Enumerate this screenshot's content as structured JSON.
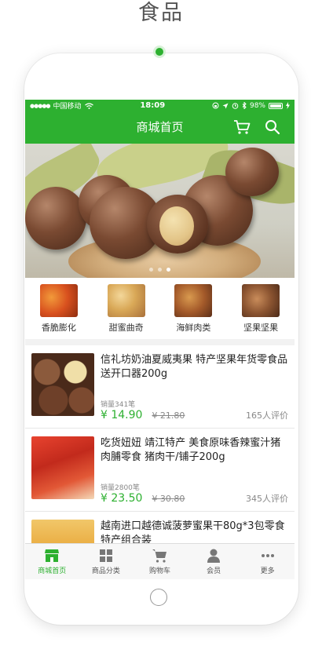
{
  "page_title": "食品",
  "status_bar": {
    "carrier": "中国移动",
    "time": "18:09",
    "battery": "98%"
  },
  "nav": {
    "title": "商城首页",
    "icons": [
      "cart-icon",
      "search-icon"
    ]
  },
  "banner": {
    "page_indicator": {
      "count": 3,
      "active": 2
    }
  },
  "categories": [
    {
      "label": "香脆膨化"
    },
    {
      "label": "甜蜜曲奇"
    },
    {
      "label": "海鲜肉类"
    },
    {
      "label": "坚果坚果"
    }
  ],
  "products": [
    {
      "title": "信礼坊奶油夏威夷果 特产坚果年货零食品 送开口器200g",
      "sales": "销量341笔",
      "price": "¥ 14.90",
      "old_price": "¥ 21.80",
      "reviews": "165人评价"
    },
    {
      "title": "吃货妞妞 靖江特产 美食原味香辣蜜汁猪肉脯零食 猪肉干/铺子200g",
      "sales": "销量2800笔",
      "price": "¥ 23.50",
      "old_price": "¥ 30.80",
      "reviews": "345人评价"
    },
    {
      "title": "越南进口越德诚菠萝蜜果干80g*3包零食特产组合装",
      "sales": "",
      "price": "",
      "old_price": "",
      "reviews": ""
    }
  ],
  "tabbar": [
    {
      "label": "商城首页",
      "icon": "store-icon",
      "active": true
    },
    {
      "label": "商品分类",
      "icon": "grid-icon",
      "active": false
    },
    {
      "label": "购物车",
      "icon": "cart-icon",
      "active": false
    },
    {
      "label": "会员",
      "icon": "user-icon",
      "active": false
    },
    {
      "label": "更多",
      "icon": "more-icon",
      "active": false
    }
  ],
  "colors": {
    "brand_green": "#2db030",
    "price_green": "#2db030",
    "text": "#222222",
    "muted": "#888888"
  }
}
